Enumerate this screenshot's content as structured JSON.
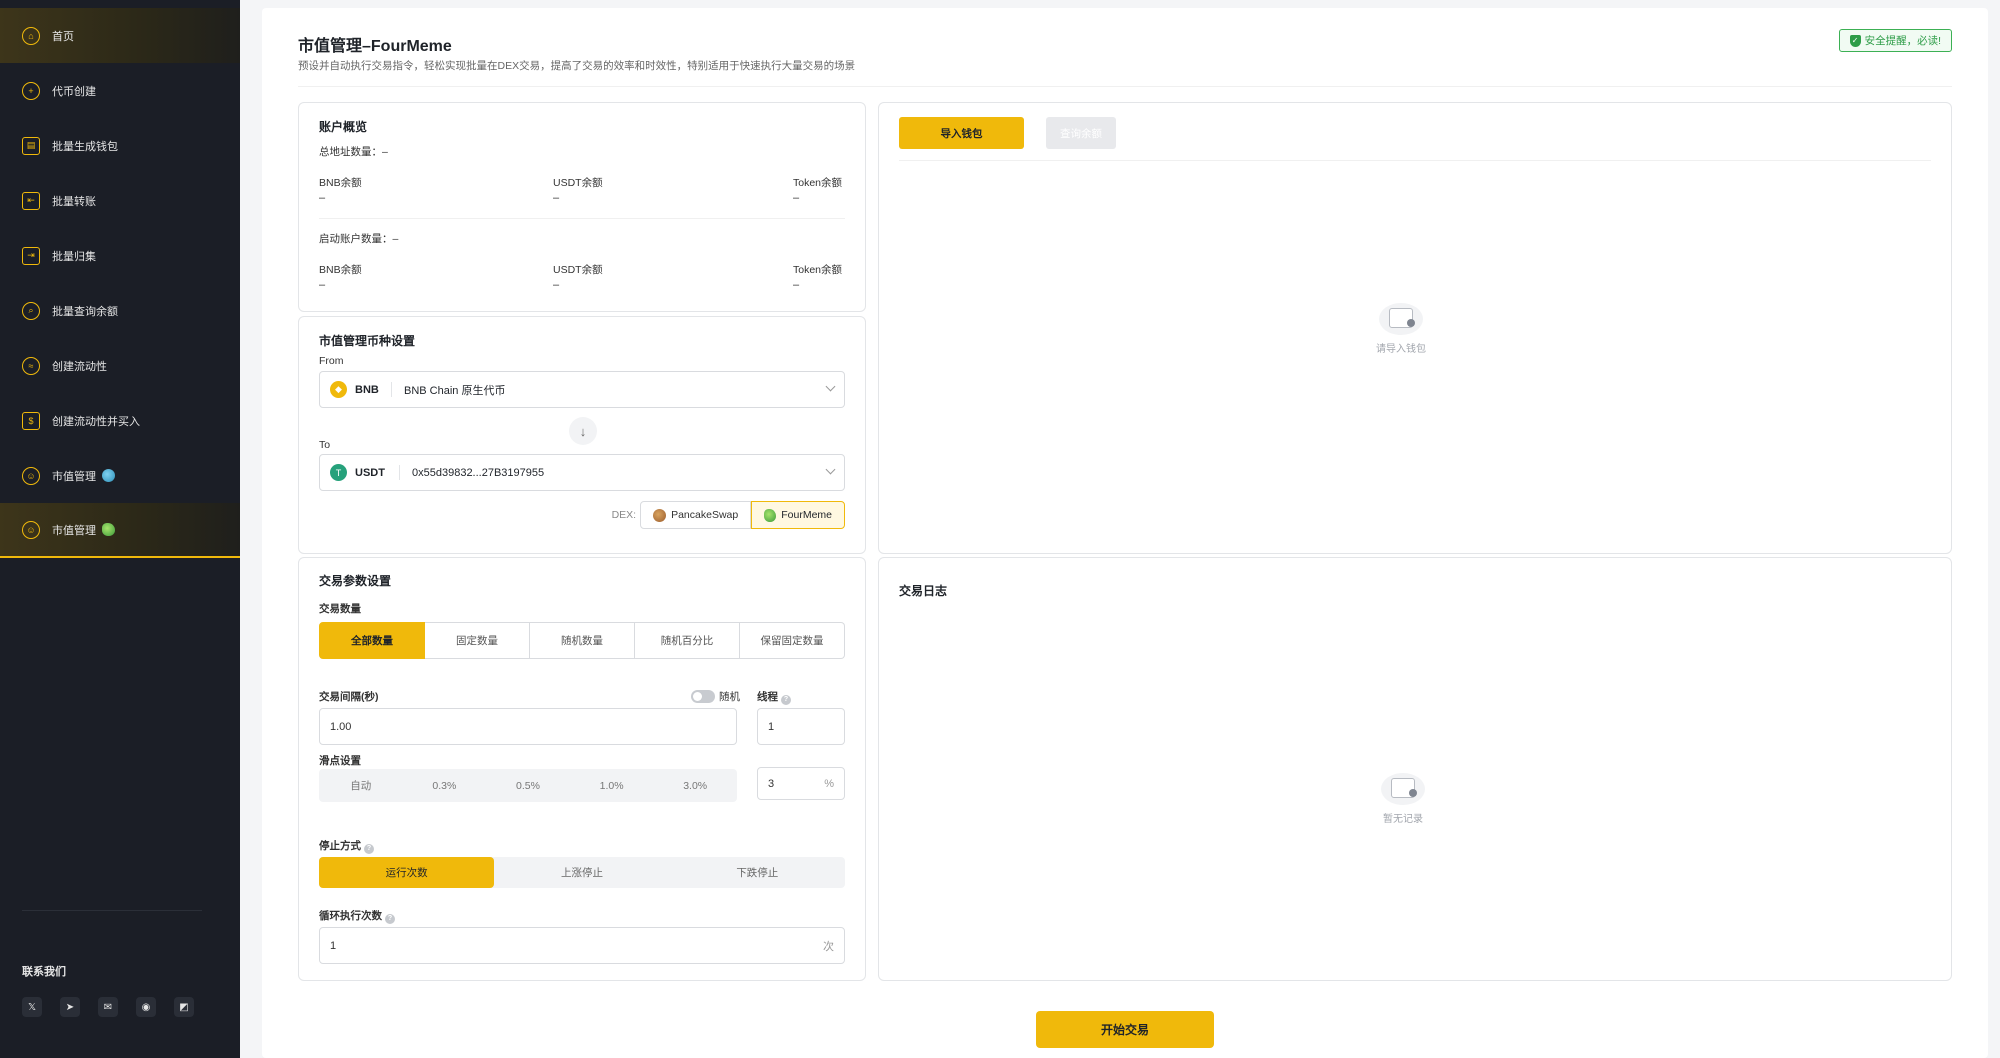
{
  "sidebar": {
    "items": [
      {
        "label": "首页",
        "icon": "home-icon"
      },
      {
        "label": "代币创建",
        "icon": "plus-circle-icon"
      },
      {
        "label": "批量生成钱包",
        "icon": "wallet-icon"
      },
      {
        "label": "批量转账",
        "icon": "transfer-icon"
      },
      {
        "label": "批量归集",
        "icon": "collect-icon"
      },
      {
        "label": "批量查询余额",
        "icon": "search-balance-icon"
      },
      {
        "label": "创建流动性",
        "icon": "liquidity-icon"
      },
      {
        "label": "创建流动性并买入",
        "icon": "liquidity-buy-icon"
      },
      {
        "label": "市值管理",
        "icon": "market-cap-icon"
      },
      {
        "label": "市值管理",
        "icon": "market-cap-icon"
      }
    ],
    "contact_title": "联系我们",
    "socials": [
      "x-icon",
      "telegram-icon",
      "mail-icon",
      "github-icon",
      "app-icon"
    ]
  },
  "header": {
    "title": "市值管理–FourMeme",
    "description": "预设并自动执行交易指令，轻松实现批量在DEX交易，提高了交易的效率和时效性，特别适用于快速执行大量交易的场景",
    "safety_notice": "安全提醒，必读!"
  },
  "account": {
    "title": "账户概览",
    "total_label": "总地址数量：",
    "total_value": "–",
    "active_label": "启动账户数量：",
    "active_value": "–",
    "bnb_label": "BNB余额",
    "usdt_label": "USDT余额",
    "token_label": "Token余额",
    "bnb_value": "–",
    "usdt_value": "–",
    "token_value": "–",
    "bnb_value2": "–",
    "usdt_value2": "–",
    "token_value2": "–"
  },
  "token_settings": {
    "title": "市值管理币种设置",
    "from_label": "From",
    "from_symbol": "BNB",
    "from_desc": "BNB Chain 原生代币",
    "to_label": "To",
    "to_symbol": "USDT",
    "to_address": "0x55d39832...27B3197955",
    "dex_label": "DEX:",
    "dex_options": [
      "PancakeSwap",
      "FourMeme"
    ],
    "dex_selected": "FourMeme"
  },
  "params": {
    "title": "交易参数设置",
    "qty_label": "交易数量",
    "qty_tabs": [
      "全部数量",
      "固定数量",
      "随机数量",
      "随机百分比",
      "保留固定数量"
    ],
    "qty_selected": "全部数量",
    "interval_label": "交易间隔(秒)",
    "random_label": "随机",
    "interval_value": "1.00",
    "threads_label": "线程",
    "threads_value": "1",
    "slippage_label": "滑点设置",
    "slippage_options": [
      "自动",
      "0.3%",
      "0.5%",
      "1.0%",
      "3.0%"
    ],
    "slippage_value": "3",
    "slippage_unit": "%",
    "stop_label": "停止方式",
    "stop_options": [
      "运行次数",
      "上涨停止",
      "下跌停止"
    ],
    "stop_selected": "运行次数",
    "loop_label": "循环执行次数",
    "loop_value": "1",
    "loop_unit": "次"
  },
  "wallet": {
    "import_button": "导入钱包",
    "query_button": "查询余额",
    "empty_text": "请导入钱包"
  },
  "log": {
    "title": "交易日志",
    "empty_text": "暂无记录"
  },
  "start_button": "开始交易",
  "colors": {
    "accent": "#f0b90b",
    "sidebar_bg": "#1b1e26",
    "safety_green": "#2e9d48"
  }
}
